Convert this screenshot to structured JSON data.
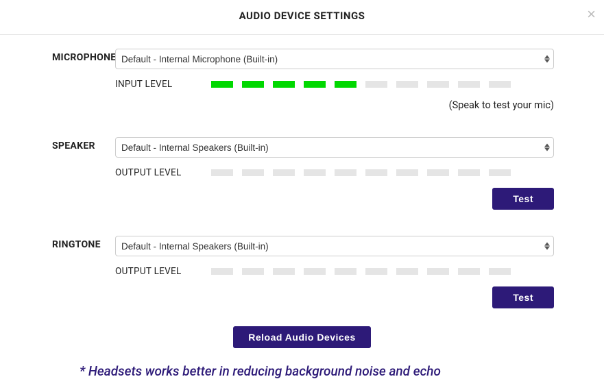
{
  "header": {
    "title": "AUDIO DEVICE SETTINGS"
  },
  "microphone": {
    "label": "MICROPHONE",
    "selected": "Default - Internal Microphone (Built-in)",
    "level_label": "INPUT LEVEL",
    "active_bars": 5,
    "total_bars": 10,
    "hint": "(Speak to test your mic)"
  },
  "speaker": {
    "label": "SPEAKER",
    "selected": "Default - Internal Speakers (Built-in)",
    "level_label": "OUTPUT LEVEL",
    "active_bars": 0,
    "total_bars": 10,
    "test_label": "Test"
  },
  "ringtone": {
    "label": "RINGTONE",
    "selected": "Default - Internal Speakers (Built-in)",
    "level_label": "OUTPUT LEVEL",
    "active_bars": 0,
    "total_bars": 10,
    "test_label": "Test"
  },
  "reload_label": "Reload Audio Devices",
  "footnote": "* Headsets works better in reducing background noise and echo",
  "colors": {
    "accent": "#2d1a78",
    "active_bar": "#00d800",
    "inactive_bar": "#e5e5e5"
  }
}
